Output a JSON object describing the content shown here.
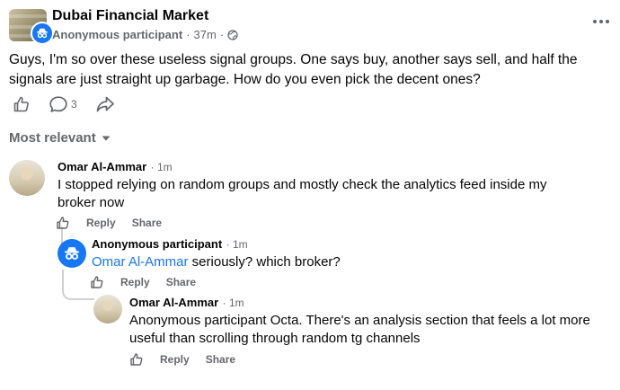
{
  "post": {
    "group_name": "Dubai Financial Market",
    "author": "Anonymous participant",
    "separator": "·",
    "time": "37m",
    "text": "Guys, I'm so over these useless signal groups. One says buy, another says sell, and half the signals are just straight up garbage. How do you even pick the decent ones?",
    "comment_count": "3"
  },
  "sort_label": "Most relevant",
  "comments": [
    {
      "author": "Omar Al-Ammar",
      "time": "· 1m",
      "text": "I stopped relying on random groups and mostly check the analytics feed inside my broker now",
      "reply_label": "Reply",
      "share_label": "Share"
    },
    {
      "author": "Anonymous participant",
      "time": "· 1m",
      "mention": "Omar Al-Ammar",
      "text": " seriously? which broker?",
      "reply_label": "Reply",
      "share_label": "Share"
    },
    {
      "author": "Omar Al-Ammar",
      "time": "· 1m",
      "text": "Anonymous participant Octa. There's an analysis section that feels a lot more useful than scrolling through random tg channels",
      "reply_label": "Reply",
      "share_label": "Share"
    }
  ],
  "icons": {
    "more": "more-horizontal-icon",
    "globe": "globe-icon",
    "like": "thumbs-up-icon",
    "comment": "comment-icon",
    "share": "share-arrow-icon",
    "dropdown": "caret-down-icon",
    "anonymous": "anonymous-detective-icon"
  },
  "colors": {
    "link_blue": "#1877f2",
    "secondary_text": "#65676b",
    "thread_line": "#ced0d4"
  }
}
